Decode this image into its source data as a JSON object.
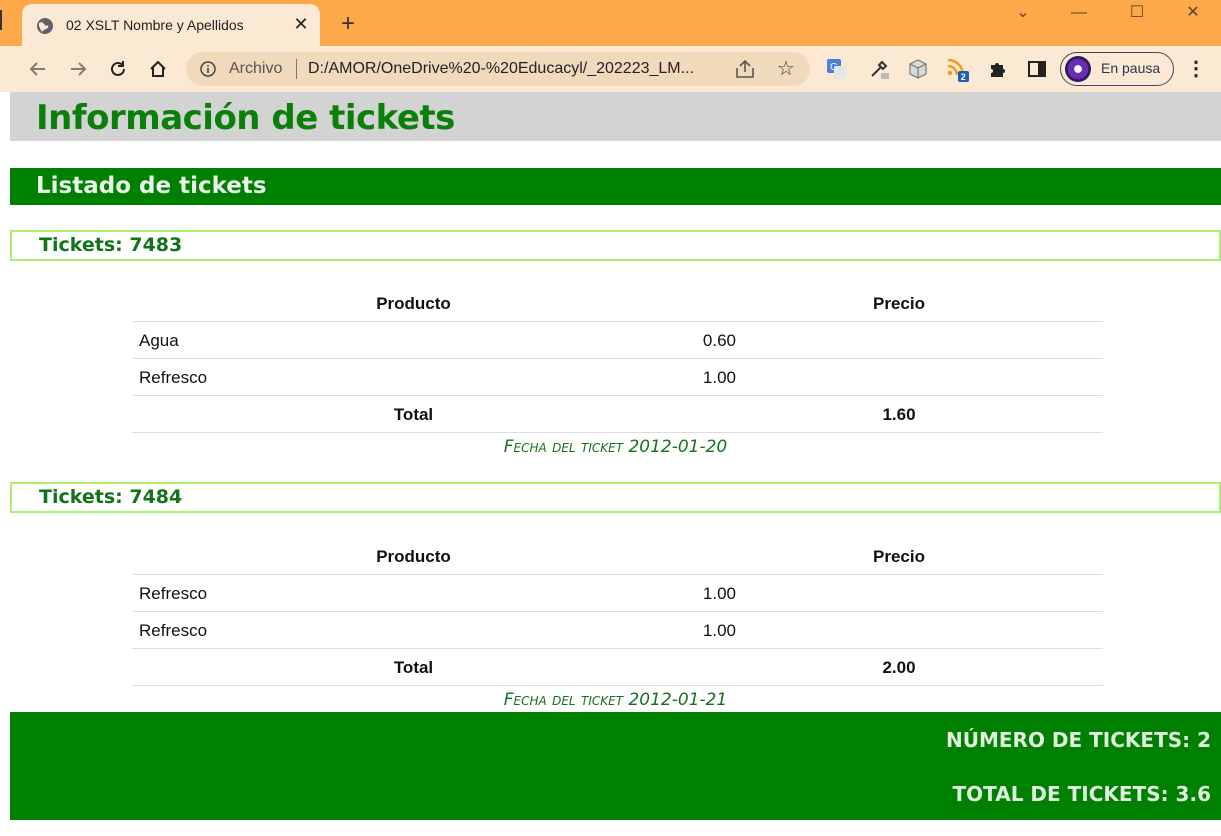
{
  "browser": {
    "tab_title": "02 XSLT Nombre y Apellidos",
    "tab_close": "✕",
    "new_tab": "+",
    "url_scheme": "Archivo",
    "url": "D:/AMOR/OneDrive%20-%20Educacyl/_202223_LM...",
    "profile_label": "En pausa",
    "extension_badge": "2",
    "win_minimize": "—",
    "win_maximize": "☐",
    "win_close": "✕",
    "win_restore_menu": "⌄"
  },
  "page": {
    "title": "Información de tickets",
    "section_title": "Listado de tickets",
    "tickets": [
      {
        "heading": "Tickets: 7483",
        "col_product": "Producto",
        "col_price": "Precio",
        "items": [
          {
            "product": "Agua",
            "price": "0.60"
          },
          {
            "product": "Refresco",
            "price": "1.00"
          }
        ],
        "total_label": "Total",
        "total_value": "1.60",
        "date_line": "Fecha del ticket 2012-01-20"
      },
      {
        "heading": "Tickets: 7484",
        "col_product": "Producto",
        "col_price": "Precio",
        "items": [
          {
            "product": "Refresco",
            "price": "1.00"
          },
          {
            "product": "Refresco",
            "price": "1.00"
          }
        ],
        "total_label": "Total",
        "total_value": "2.00",
        "date_line": "Fecha del ticket 2012-01-21"
      }
    ],
    "footer": {
      "count_line": "NÚMERO DE TICKETS: 2",
      "total_line": "TOTAL DE TICKETS: 3.6"
    }
  },
  "colors": {
    "tabbar": "#fda94a",
    "toolbar": "#fbe9d3",
    "heading_green": "#0a7f0a",
    "bar_green": "#008000",
    "ticket_border": "#adef6e"
  }
}
